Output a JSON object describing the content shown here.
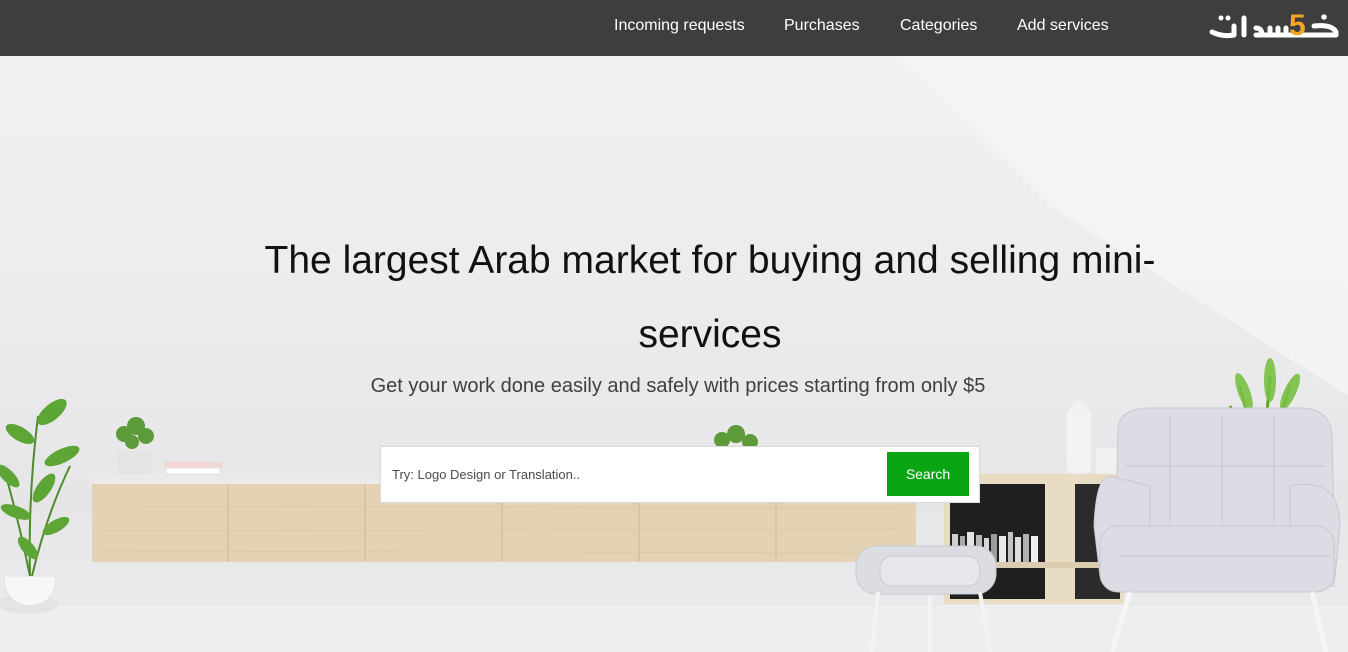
{
  "nav": {
    "items": [
      {
        "label": "Incoming requests"
      },
      {
        "label": "Purchases"
      },
      {
        "label": "Categories"
      },
      {
        "label": "Add services"
      }
    ],
    "logo_text": "خ5سات",
    "logo_accent_color": "#f5a623"
  },
  "hero": {
    "headline": "The largest Arab market for buying and selling mini-services",
    "subheadline": "Get your work done easily and safely with prices starting from only $5"
  },
  "search": {
    "placeholder": "Try: Logo Design or Translation..",
    "value": "",
    "button_label": "Search",
    "button_color": "#0aa512"
  }
}
